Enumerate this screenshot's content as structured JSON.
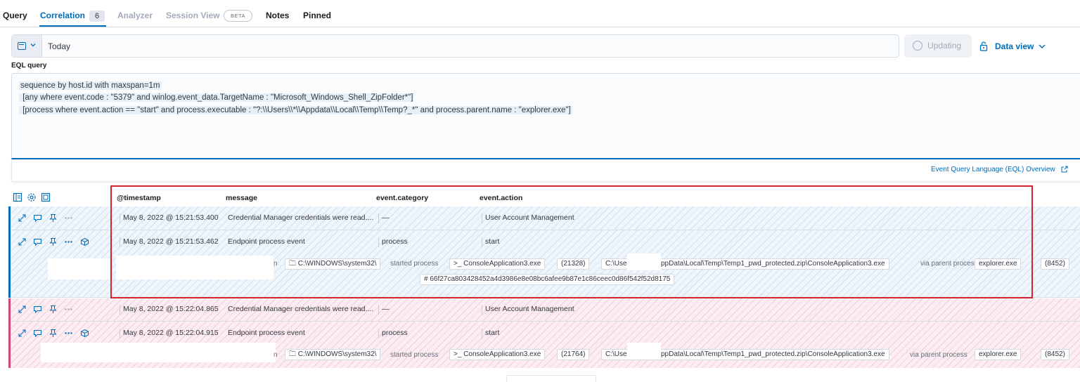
{
  "tabs": [
    {
      "label": "Query"
    },
    {
      "label": "Correlation",
      "count": "6"
    },
    {
      "label": "Analyzer"
    },
    {
      "label": "Session View",
      "badge": "BETA"
    },
    {
      "label": "Notes"
    },
    {
      "label": "Pinned"
    }
  ],
  "datepicker": {
    "value": "Today"
  },
  "updating_label": "Updating",
  "data_view_label": "Data view",
  "eql": {
    "label": "EQL query",
    "lines": [
      "sequence by host.id with maxspan=1m",
      " [any where event.code : \"5379\" and winlog.event_data.TargetName : \"Microsoft_Windows_Shell_ZipFolder*\"]",
      " [process where event.action == \"start\" and process.executable : \"?:\\\\Users\\\\*\\\\Appdata\\\\Local\\\\Temp\\\\Temp?_*\" and process.parent.name : \"explorer.exe\"]"
    ],
    "overview_link": "Event Query Language (EQL) Overview"
  },
  "columns": [
    "@timestamp",
    "message",
    "event.category",
    "event.action"
  ],
  "rows": [
    {
      "timestamp": "May 8, 2022 @ 15:21:53.400",
      "message": "Credential Manager credentials were read....",
      "category": "—",
      "action": "User Account Management"
    },
    {
      "timestamp": "May 8, 2022 @ 15:21:53.462",
      "message": "Endpoint process event",
      "category": "process",
      "action": "start"
    },
    {
      "timestamp": "May 8, 2022 @ 15:22:04.865",
      "message": "Credential Manager credentials were read....",
      "category": "—",
      "action": "User Account Management"
    },
    {
      "timestamp": "May 8, 2022 @ 15:22:04.915",
      "message": "Endpoint process event",
      "category": "process",
      "action": "start"
    }
  ],
  "process_chain_1": {
    "lead": "n",
    "dir": "C:\\WINDOWS\\system32\\",
    "verb": "started process",
    "process": ">_ ConsoleApplication3.exe",
    "pid": "(21328)",
    "path_start": "C:\\Use",
    "path_end": "ppData\\Local\\Temp\\Temp1_pwd_protected.zip\\ConsoleApplication3.exe",
    "via": "via parent process",
    "parent": "explorer.exe",
    "ppid": "(8452)",
    "hash": "# 66f27ca803428452a4d3986e8e08bc6afee9b87e1c86ceec0d86f542f52d8175"
  },
  "process_chain_2": {
    "lead": "n",
    "dir": "C:\\WINDOWS\\system32\\",
    "verb": "started process",
    "process": ">_ ConsoleApplication3.exe",
    "pid": "(21764)",
    "path_start": "C:\\Use",
    "path_end": "ppData\\Local\\Temp\\Temp1_pwd_protected.zip\\ConsoleApplication3.exe",
    "via": "via parent process",
    "parent": "explorer.exe",
    "ppid": "(8452)"
  },
  "colors": {
    "accent": "#006bb8",
    "highlight_box": "#d1242f",
    "seq_blue": "#006bb8",
    "seq_pink": "#d6447d"
  }
}
